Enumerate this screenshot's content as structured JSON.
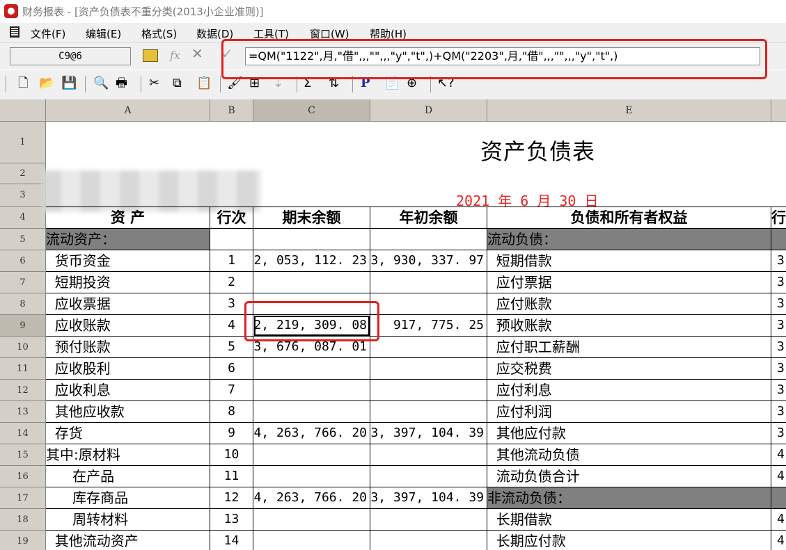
{
  "window": {
    "title": "财务报表 - [资产负债表不重分类(2013小企业准则)]"
  },
  "menu": [
    "文件(F)",
    "编辑(E)",
    "格式(S)",
    "数据(D)",
    "工具(T)",
    "窗口(W)",
    "帮助(H)"
  ],
  "formula_bar": {
    "cell_ref": "C9@6",
    "formula": "=QM(\"1122\",月,\"借\",,,\"\",,,\"y\",\"t\",)+QM(\"2203\",月,\"借\",,,\"\",,,\"y\",\"t\",)"
  },
  "toolbar_icons": [
    "new-icon",
    "open-icon",
    "save-icon",
    "print-preview-icon",
    "print-icon",
    "cut-icon",
    "copy-icon",
    "paste-icon",
    "format-painter-icon",
    "insert-icon",
    "sort-asc-icon",
    "sum-icon",
    "sort-desc-icon",
    "p-icon",
    "page-icon",
    "zoom-icon",
    "help-icon"
  ],
  "columns": [
    "A",
    "B",
    "C",
    "D",
    "E"
  ],
  "rows": [
    "1",
    "2",
    "3",
    "4",
    "5",
    "6",
    "7",
    "8",
    "9",
    "10",
    "11",
    "12",
    "13",
    "14",
    "15",
    "16",
    "17",
    "18",
    "19"
  ],
  "report": {
    "title": "资产负债表",
    "date": "2021 年   6 月  30 日",
    "headers": {
      "asset": "资   产",
      "line_no": "行次",
      "end_balance": "期末余额",
      "begin_balance": "年初余额",
      "liability": "负债和所有者权益",
      "line_no2": "行"
    }
  },
  "assets": [
    {
      "name": "流动资产：",
      "line": "",
      "end": "",
      "begin": ""
    },
    {
      "name": "  货币资金",
      "line": "1",
      "end": "2, 053, 112. 23",
      "begin": "3, 930, 337. 97"
    },
    {
      "name": "  短期投资",
      "line": "2",
      "end": "",
      "begin": ""
    },
    {
      "name": "  应收票据",
      "line": "3",
      "end": "",
      "begin": ""
    },
    {
      "name": "  应收账款",
      "line": "4",
      "end": "2, 219, 309. 08",
      "begin": "917, 775. 25"
    },
    {
      "name": "  预付账款",
      "line": "5",
      "end": "3, 676, 087. 01",
      "begin": ""
    },
    {
      "name": "  应收股利",
      "line": "6",
      "end": "",
      "begin": ""
    },
    {
      "name": "  应收利息",
      "line": "7",
      "end": "",
      "begin": ""
    },
    {
      "name": "  其他应收款",
      "line": "8",
      "end": "",
      "begin": ""
    },
    {
      "name": "  存货",
      "line": "9",
      "end": "4, 263, 766. 20",
      "begin": "3, 397, 104. 39"
    },
    {
      "name": "其中:原材料",
      "line": "10",
      "end": "",
      "begin": ""
    },
    {
      "name": "      在产品",
      "line": "11",
      "end": "",
      "begin": ""
    },
    {
      "name": "      库存商品",
      "line": "12",
      "end": "4, 263, 766. 20",
      "begin": "3, 397, 104. 39"
    },
    {
      "name": "      周转材料",
      "line": "13",
      "end": "",
      "begin": ""
    },
    {
      "name": "  其他流动资产",
      "line": "14",
      "end": "",
      "begin": ""
    }
  ],
  "liabilities": [
    "流动负债：",
    "  短期借款",
    "  应付票据",
    "  应付账款",
    "  预收账款",
    "  应付职工薪酬",
    "  应交税费",
    "  应付利息",
    "  应付利润",
    "  其他应付款",
    "  其他流动负债",
    "  流动负债合计",
    "非流动负债：",
    "  长期借款",
    "  长期应付款"
  ],
  "liability_line_partial": [
    "",
    "3",
    "3",
    "3",
    "3",
    "3",
    "3",
    "3",
    "3",
    "3",
    "4",
    "4",
    "",
    "4",
    "4"
  ]
}
